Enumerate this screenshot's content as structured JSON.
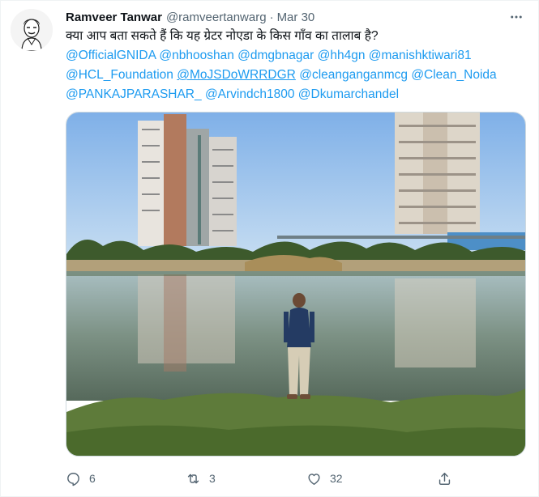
{
  "tweet": {
    "author_name": "Ramveer Tanwar",
    "handle": "@ramveertanwarg",
    "separator": "·",
    "date": "Mar 30",
    "lines": [
      [
        {
          "text": "क्या आप बता सकते हैं कि यह ग्रेटर नोएडा के किस गाँव का तालाब है?",
          "type": "plain"
        }
      ],
      [
        {
          "text": "@OfficialGNIDA",
          "type": "mention"
        },
        {
          "text": " ",
          "type": "plain"
        },
        {
          "text": "@nbhooshan",
          "type": "mention"
        },
        {
          "text": " ",
          "type": "plain"
        },
        {
          "text": "@dmgbnagar",
          "type": "mention"
        },
        {
          "text": " ",
          "type": "plain"
        },
        {
          "text": "@hh4gn",
          "type": "mention"
        },
        {
          "text": " ",
          "type": "plain"
        },
        {
          "text": "@manishktiwari81",
          "type": "mention"
        }
      ],
      [
        {
          "text": "@HCL_Foundation",
          "type": "mention"
        },
        {
          "text": " ",
          "type": "plain"
        },
        {
          "text": "@MoJSDoWRRDGR",
          "type": "mention-underline"
        },
        {
          "text": " ",
          "type": "plain"
        },
        {
          "text": "@cleanganganmcg",
          "type": "mention"
        },
        {
          "text": " ",
          "type": "plain"
        },
        {
          "text": "@Clean_Noida",
          "type": "mention"
        }
      ],
      [
        {
          "text": "@PANKAJPARASHAR_",
          "type": "mention"
        },
        {
          "text": " ",
          "type": "plain"
        },
        {
          "text": "@Arvindch1800",
          "type": "mention"
        },
        {
          "text": " ",
          "type": "plain"
        },
        {
          "text": "@Dkumarchandel",
          "type": "mention"
        }
      ]
    ]
  },
  "actions": {
    "reply_count": "6",
    "retweet_count": "3",
    "like_count": "32"
  },
  "icons": {
    "more": "more-dots-icon",
    "reply": "reply-bubble-icon",
    "retweet": "retweet-icon",
    "like": "heart-icon",
    "share": "share-icon"
  },
  "colors": {
    "text": "#0f1419",
    "secondary": "#536471",
    "link": "#1d9bf0",
    "border": "#cfd9de"
  }
}
